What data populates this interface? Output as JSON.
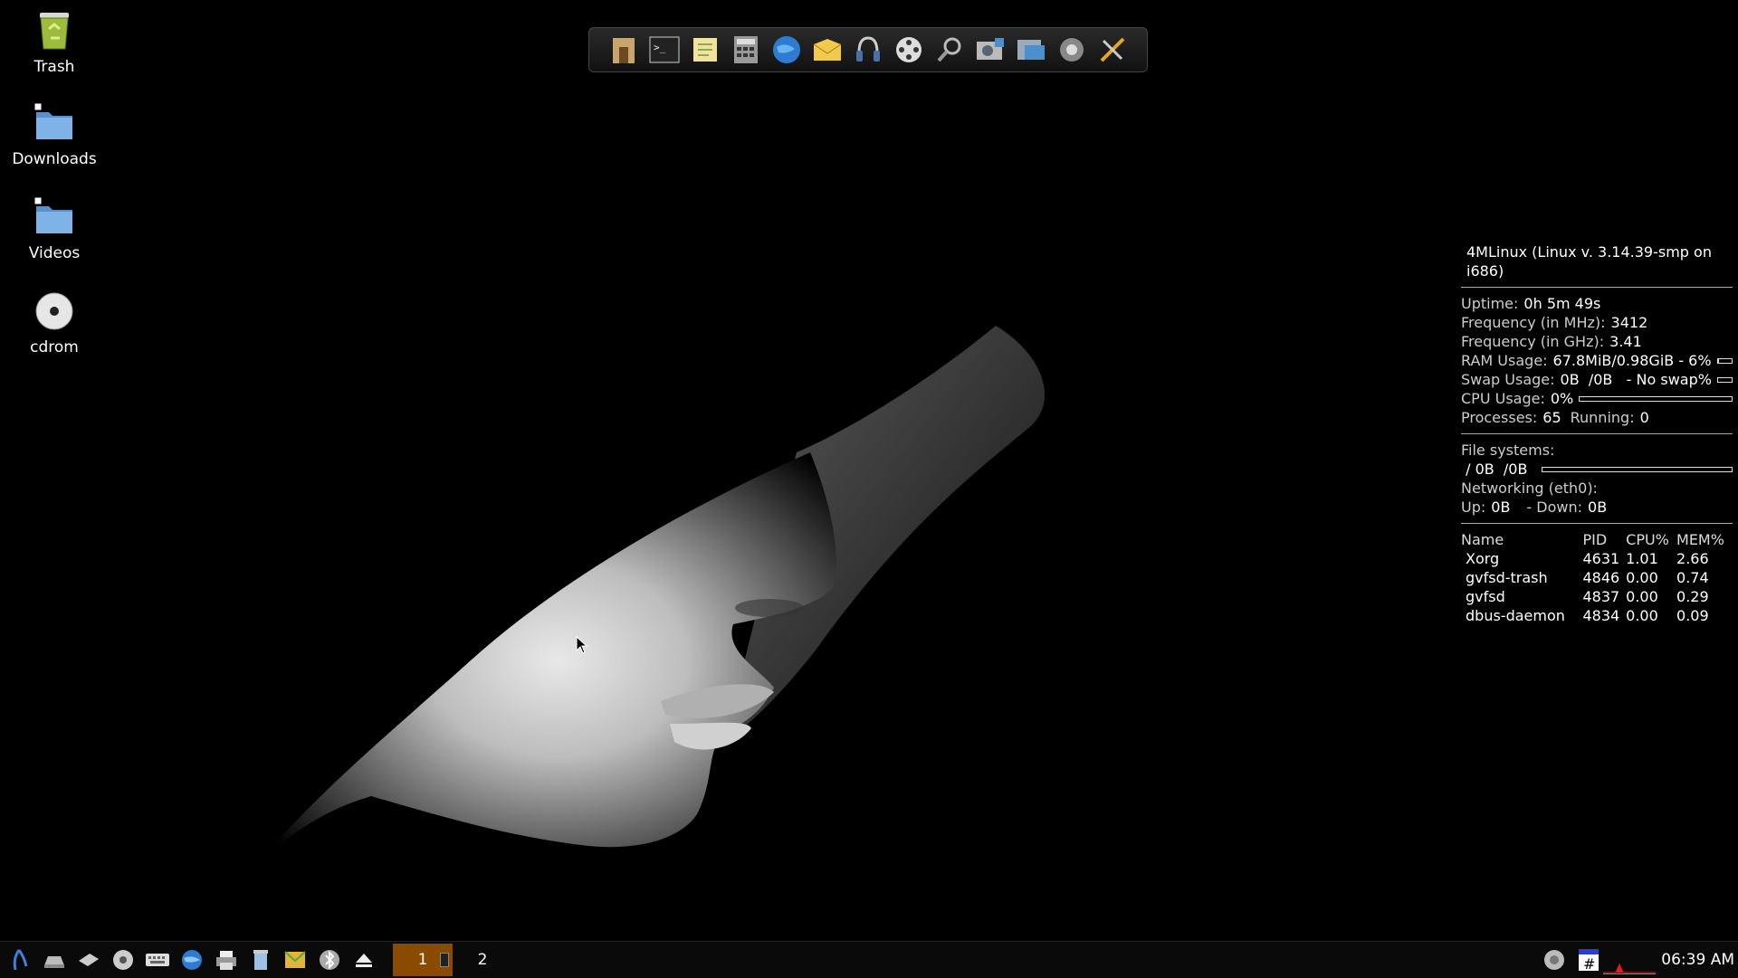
{
  "desktop": {
    "icons": [
      {
        "label": "Trash",
        "icon": "trash-icon"
      },
      {
        "label": "Downloads",
        "icon": "folder-icon"
      },
      {
        "label": "Videos",
        "icon": "folder-icon"
      },
      {
        "label": "cdrom",
        "icon": "cdrom-icon"
      }
    ]
  },
  "dock": {
    "items": [
      "home-folder-icon",
      "terminal-icon",
      "text-editor-icon",
      "calculator-icon",
      "web-browser-icon",
      "mail-icon",
      "audio-player-icon",
      "video-player-icon",
      "search-icon",
      "image-viewer-icon",
      "file-manager-icon",
      "settings-icon",
      "tools-icon"
    ]
  },
  "conky": {
    "title": "4MLinux (Linux v. 3.14.39-smp on i686)",
    "uptime_label": "Uptime:",
    "uptime": "0h 5m 49s",
    "freq_mhz_label": "Frequency (in MHz):",
    "freq_mhz": "3412",
    "freq_ghz_label": "Frequency (in GHz):",
    "freq_ghz": "3.41",
    "ram_label": "RAM Usage:",
    "ram": "67.8MiB/0.98GiB - 6%",
    "ram_fraction": 0.06,
    "swap_label": "Swap Usage:",
    "swap": "0B  /0B   - No swap%",
    "swap_fraction": 0,
    "cpu_label": "CPU Usage:",
    "cpu": "0%",
    "cpu_fraction": 0,
    "proc_label": "Processes:",
    "procs": "65",
    "running_label": "Running:",
    "running": "0",
    "fs_label": "File systems:",
    "fs_root": " / 0B  /0B",
    "fs_fraction": 0,
    "net_label": "Networking (eth0):",
    "up_label": "Up:",
    "up": "0B",
    "down_label": "- Down:",
    "down": "0B",
    "table": {
      "headers": [
        "Name",
        "PID",
        "CPU%",
        "MEM%"
      ],
      "rows": [
        [
          "Xorg",
          "4631",
          "1.01",
          "2.66"
        ],
        [
          "gvfsd-trash",
          "4846",
          "0.00",
          "0.74"
        ],
        [
          "gvfsd",
          "4837",
          "0.00",
          "0.29"
        ],
        [
          "dbus-daemon",
          "4834",
          "0.00",
          "0.09"
        ]
      ]
    }
  },
  "taskbar": {
    "launchers": [
      "start-menu-icon",
      "drive-icon",
      "network-icon",
      "disk-icon",
      "keyboard-icon",
      "globe-icon",
      "printer-icon",
      "trash-can-icon",
      "mail-icon",
      "bluetooth-icon",
      "eject-icon"
    ],
    "workspaces": [
      "1",
      "2"
    ],
    "active_workspace": "1",
    "clock": "06:39 AM",
    "accent": "#8a4a00"
  }
}
